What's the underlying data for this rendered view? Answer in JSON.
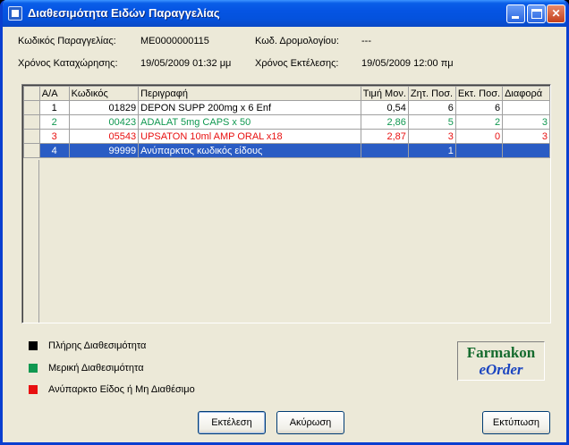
{
  "window": {
    "title": "Διαθεσιμότητα Ειδών Παραγγελίας"
  },
  "info": {
    "order_code_label": "Κωδικός Παραγγελίας:",
    "order_code_value": "ME0000000115",
    "route_code_label": "Κωδ. Δρομολογίου:",
    "route_code_value": "---",
    "registered_label": "Χρόνος Καταχώρησης:",
    "registered_value": "19/05/2009 01:32 μμ",
    "executed_label": "Χρόνος Εκτέλεσης:",
    "executed_value": "19/05/2009 12:00 πμ"
  },
  "grid": {
    "columns": [
      "Α/Α",
      "Κωδικός",
      "Περιγραφή",
      "Τιμή Μον.",
      "Ζητ. Ποσ.",
      "Εκτ. Ποσ.",
      "Διαφορά"
    ],
    "rows": [
      {
        "aa": "1",
        "code": "01829",
        "desc": "DEPON SUPP 200mg x 6 Enf",
        "price": "0,54",
        "req": "6",
        "exec": "6",
        "diff": "",
        "status": "full"
      },
      {
        "aa": "2",
        "code": "00423",
        "desc": "ADALAT  5mg CAPS x 50",
        "price": "2,86",
        "req": "5",
        "exec": "2",
        "diff": "3",
        "status": "partial"
      },
      {
        "aa": "3",
        "code": "05543",
        "desc": "UPSATON 10ml AMP ORAL  x18",
        "price": "2,87",
        "req": "3",
        "exec": "0",
        "diff": "3",
        "status": "unavailable"
      },
      {
        "aa": "4",
        "code": "99999",
        "desc": "Ανύπαρκτος κωδικός είδους",
        "price": "",
        "req": "1",
        "exec": "",
        "diff": "",
        "status": "selected"
      }
    ]
  },
  "legend": [
    {
      "color": "#000000",
      "label": "Πλήρης Διαθεσιμότητα"
    },
    {
      "color": "#109850",
      "label": "Μερική Διαθεσιμότητα"
    },
    {
      "color": "#e81010",
      "label": "Ανύπαρκτο Είδος ή Μη Διαθέσιμο"
    }
  ],
  "logo": {
    "line1": "Farmakon",
    "line2": "eOrder"
  },
  "buttons": {
    "execute": "Εκτέλεση",
    "cancel": "Ακύρωση",
    "print": "Εκτύπωση"
  }
}
